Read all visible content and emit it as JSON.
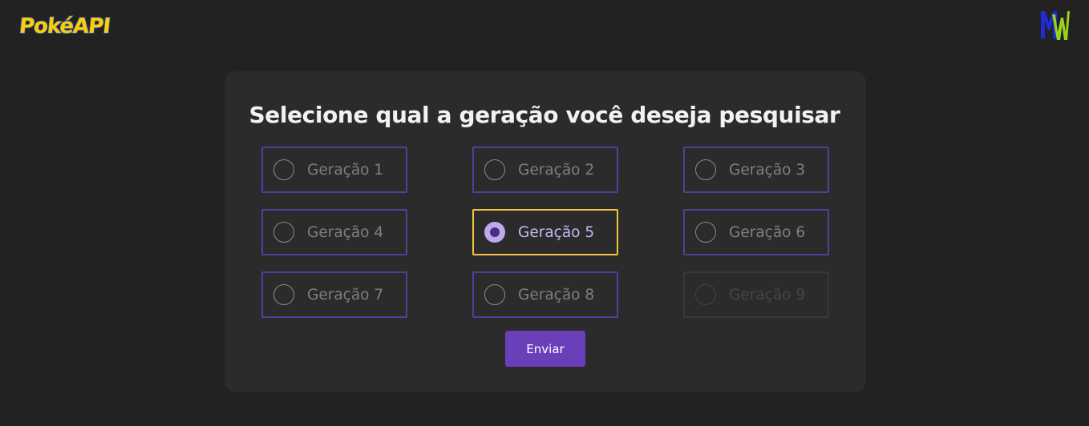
{
  "header": {
    "logo_text": "PokéAPI",
    "logo_colors": {
      "fill": "#ffcb05",
      "outline": "#2a5fb0"
    },
    "brand_mark": "MW",
    "brand_colors": {
      "m": "#1f2bd4",
      "w": "#9ad21c"
    }
  },
  "form": {
    "title": "Selecione qual a geração você deseja pesquisar",
    "options": [
      {
        "label": "Geração 1",
        "state": "unchecked"
      },
      {
        "label": "Geração 2",
        "state": "unchecked"
      },
      {
        "label": "Geração 3",
        "state": "unchecked"
      },
      {
        "label": "Geração 4",
        "state": "unchecked"
      },
      {
        "label": "Geração 5",
        "state": "checked"
      },
      {
        "label": "Geração 6",
        "state": "unchecked"
      },
      {
        "label": "Geração 7",
        "state": "unchecked"
      },
      {
        "label": "Geração 8",
        "state": "unchecked"
      },
      {
        "label": "Geração 9",
        "state": "disabled"
      }
    ],
    "selected": "Geração 5",
    "submit_label": "Enviar"
  },
  "colors": {
    "background": "#222222",
    "card": "#2b2b2b",
    "option_border": "#573c9c",
    "selected_border": "#f3c242",
    "accent": "#6a3fba"
  }
}
